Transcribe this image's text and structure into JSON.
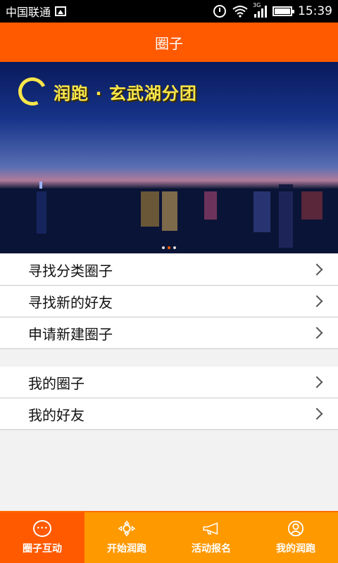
{
  "status_bar": {
    "carrier": "中国联通",
    "network_type": "3G",
    "time": "15:39",
    "icons": [
      "picture-icon",
      "alarm-icon",
      "wifi-icon",
      "signal-icon",
      "battery-icon"
    ]
  },
  "header": {
    "title": "圈子"
  },
  "banner": {
    "title": "润跑 · 玄武湖分团",
    "slide_count": 3,
    "active_slide": 2
  },
  "menu_group_1": [
    {
      "label": "寻找分类圈子"
    },
    {
      "label": "寻找新的好友"
    },
    {
      "label": "申请新建圈子"
    }
  ],
  "menu_group_2": [
    {
      "label": "我的圈子"
    },
    {
      "label": "我的好友"
    }
  ],
  "bottom_nav": [
    {
      "label": "圈子互动",
      "icon": "chat-icon",
      "active": true
    },
    {
      "label": "开始润跑",
      "icon": "move-icon",
      "active": false
    },
    {
      "label": "活动报名",
      "icon": "megaphone-icon",
      "active": false
    },
    {
      "label": "我的润跑",
      "icon": "user-icon",
      "active": false
    }
  ],
  "colors": {
    "header": "#ff5a00",
    "bottom_nav": "#ff9900",
    "bottom_nav_active": "#ff5a00",
    "banner_title": "#f8e64a"
  }
}
